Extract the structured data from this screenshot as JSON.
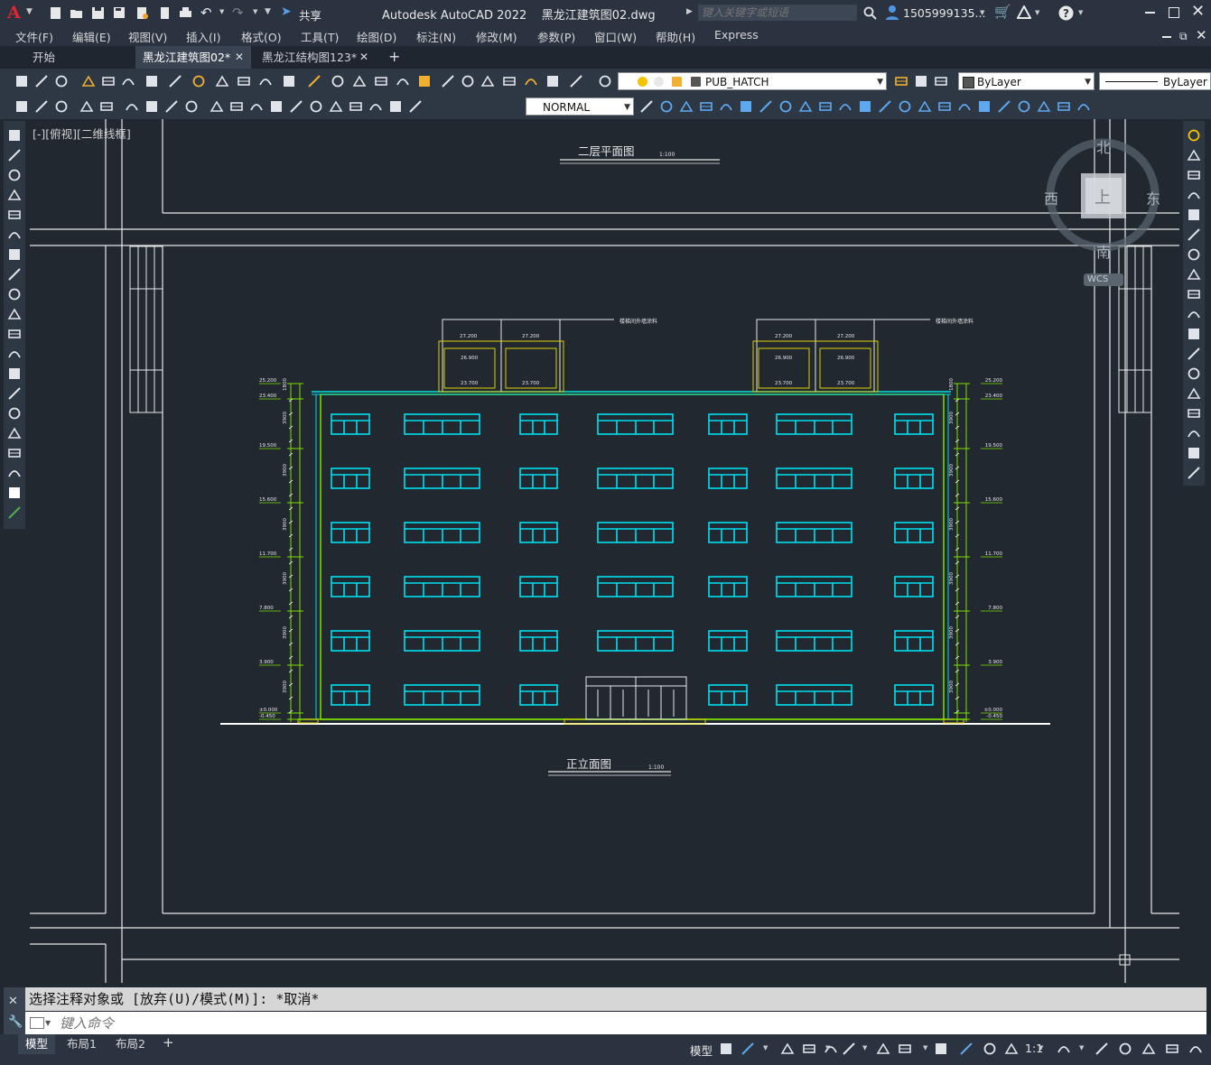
{
  "app": {
    "logo": "A",
    "title": "Autodesk AutoCAD 2022",
    "filename": "黑龙江建筑图02.dwg",
    "share_label": "共享",
    "search_placeholder": "键入关键字或短语",
    "user": "1505999135...",
    "icons": [
      "new-icon",
      "open-icon",
      "save-icon",
      "saveas-icon",
      "plot-icon",
      "undo-icon",
      "redo-icon",
      "search-icon",
      "user-icon",
      "cart-icon",
      "autodesk-icon",
      "help-icon",
      "minimize-icon",
      "maximize-icon",
      "close-icon"
    ]
  },
  "menu": {
    "items": [
      "文件(F)",
      "编辑(E)",
      "视图(V)",
      "插入(I)",
      "格式(O)",
      "工具(T)",
      "绘图(D)",
      "标注(N)",
      "修改(M)",
      "参数(P)",
      "窗口(W)",
      "帮助(H)",
      "Express"
    ]
  },
  "tabs": {
    "items": [
      {
        "label": "开始"
      },
      {
        "label": "黑龙江建筑图02*"
      },
      {
        "label": "黑龙江结构图123*"
      }
    ],
    "add_label": "+"
  },
  "toolbar": {
    "layer_value": "PUB_HATCH",
    "color_value": "ByLayer",
    "linetype_value": "ByLayer",
    "dimstyle_value": "NORMAL"
  },
  "viewport": {
    "label": "[-][俯视][二维线框]"
  },
  "viewcube": {
    "north": "北",
    "south": "南",
    "east": "东",
    "west": "西",
    "face": "上",
    "wcs": "WCS"
  },
  "drawing": {
    "plan_title": "二层平面图",
    "plan_scale": "1:100",
    "elev_title": "正立面图",
    "elev_scale": "1:100",
    "roof_note": "楼梯间外墙涂料",
    "left_levels": [
      "25.200",
      "23.400",
      "19.500",
      "15.600",
      "11.700",
      "7.800",
      "3.900",
      "±0.000",
      "-0.450"
    ],
    "right_levels": [
      "25.200",
      "23.400",
      "19.500",
      "15.600",
      "11.700",
      "7.800",
      "3.900",
      "±0.000",
      "-0.450"
    ],
    "left_dims": [
      "1800",
      "3900",
      "3900",
      "3900",
      "3900",
      "3900",
      "3900",
      "1500",
      "1400",
      "1000"
    ],
    "stair_tower_levels": [
      "27.200",
      "26.900",
      "23.700"
    ]
  },
  "command": {
    "history": "选择注释对象或 [放弃(U)/模式(M)]: *取消*",
    "input_placeholder": "键入命令"
  },
  "status": {
    "layouts": [
      {
        "label": "模型"
      },
      {
        "label": "布局1"
      },
      {
        "label": "布局2"
      }
    ],
    "add_label": "+",
    "model_label": "模型",
    "scale_label": "1:1"
  }
}
